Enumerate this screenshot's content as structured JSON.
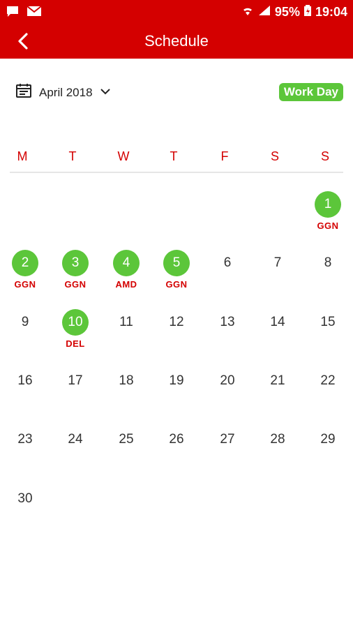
{
  "status_bar": {
    "battery": "95%",
    "time": "19:04"
  },
  "header": {
    "title": "Schedule"
  },
  "calendar": {
    "month_label": "April 2018",
    "work_day_label": "Work Day",
    "weekdays": [
      "M",
      "T",
      "W",
      "T",
      "F",
      "S",
      "S"
    ],
    "days": [
      {
        "n": "1",
        "code": "GGN",
        "hl": true
      },
      {
        "n": "2",
        "code": "GGN",
        "hl": true
      },
      {
        "n": "3",
        "code": "GGN",
        "hl": true
      },
      {
        "n": "4",
        "code": "AMD",
        "hl": true
      },
      {
        "n": "5",
        "code": "GGN",
        "hl": true
      },
      {
        "n": "6",
        "code": "",
        "hl": false
      },
      {
        "n": "7",
        "code": "",
        "hl": false
      },
      {
        "n": "8",
        "code": "",
        "hl": false
      },
      {
        "n": "9",
        "code": "",
        "hl": false
      },
      {
        "n": "10",
        "code": "DEL",
        "hl": true
      },
      {
        "n": "11",
        "code": "",
        "hl": false
      },
      {
        "n": "12",
        "code": "",
        "hl": false
      },
      {
        "n": "13",
        "code": "",
        "hl": false
      },
      {
        "n": "14",
        "code": "",
        "hl": false
      },
      {
        "n": "15",
        "code": "",
        "hl": false
      },
      {
        "n": "16",
        "code": "",
        "hl": false
      },
      {
        "n": "17",
        "code": "",
        "hl": false
      },
      {
        "n": "18",
        "code": "",
        "hl": false
      },
      {
        "n": "19",
        "code": "",
        "hl": false
      },
      {
        "n": "20",
        "code": "",
        "hl": false
      },
      {
        "n": "21",
        "code": "",
        "hl": false
      },
      {
        "n": "22",
        "code": "",
        "hl": false
      },
      {
        "n": "23",
        "code": "",
        "hl": false
      },
      {
        "n": "24",
        "code": "",
        "hl": false
      },
      {
        "n": "25",
        "code": "",
        "hl": false
      },
      {
        "n": "26",
        "code": "",
        "hl": false
      },
      {
        "n": "27",
        "code": "",
        "hl": false
      },
      {
        "n": "28",
        "code": "",
        "hl": false
      },
      {
        "n": "29",
        "code": "",
        "hl": false
      },
      {
        "n": "30",
        "code": "",
        "hl": false
      }
    ]
  },
  "colors": {
    "brand": "#d40000",
    "highlight": "#5cc63a"
  }
}
